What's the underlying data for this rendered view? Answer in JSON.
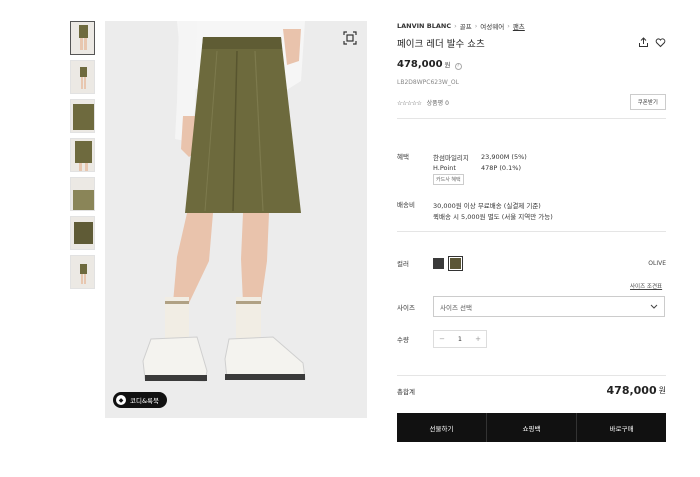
{
  "breadcrumb": {
    "brand": "LANVIN BLANC",
    "items": [
      "골프",
      "여성웨어",
      "팬츠"
    ]
  },
  "product": {
    "title": "페이크 레더 발수 쇼츠",
    "price": "478,000",
    "price_unit": "원",
    "sku": "LB2D8WPC623W_OL",
    "stars": "☆☆☆☆☆",
    "review_label": "상품평 0",
    "coupon_label": "쿠폰받기"
  },
  "benefits": {
    "label": "혜택",
    "lines": [
      {
        "k": "한섬마일리지",
        "v": "23,900M (5%)"
      },
      {
        "k": "H.Point",
        "v": "478P (0.1%)"
      }
    ],
    "card_tag": "카드사 혜택"
  },
  "shipping": {
    "label": "배송비",
    "lines": [
      "30,000원 이상 무료배송 (실결제 기준)",
      "퀵배송 시 5,000원 별도 (서울 지역만 가능)"
    ]
  },
  "options": {
    "color_label": "컬러",
    "colors": [
      "#3a3a3a",
      "#5b5636"
    ],
    "color_name": "OLIVE",
    "size_guide": "사이즈 조견표",
    "size_label": "사이즈",
    "size_placeholder": "사이즈 선택",
    "qty_label": "수량",
    "qty": "1",
    "minus": "−",
    "plus": "+"
  },
  "total": {
    "label": "총합계",
    "price": "478,000",
    "unit": "원"
  },
  "actions": {
    "gift": "선물하기",
    "bag": "쇼핑백",
    "buy": "바로구매"
  },
  "gallery": {
    "badge_label": "코디&룩북",
    "thumb_count": 7
  }
}
